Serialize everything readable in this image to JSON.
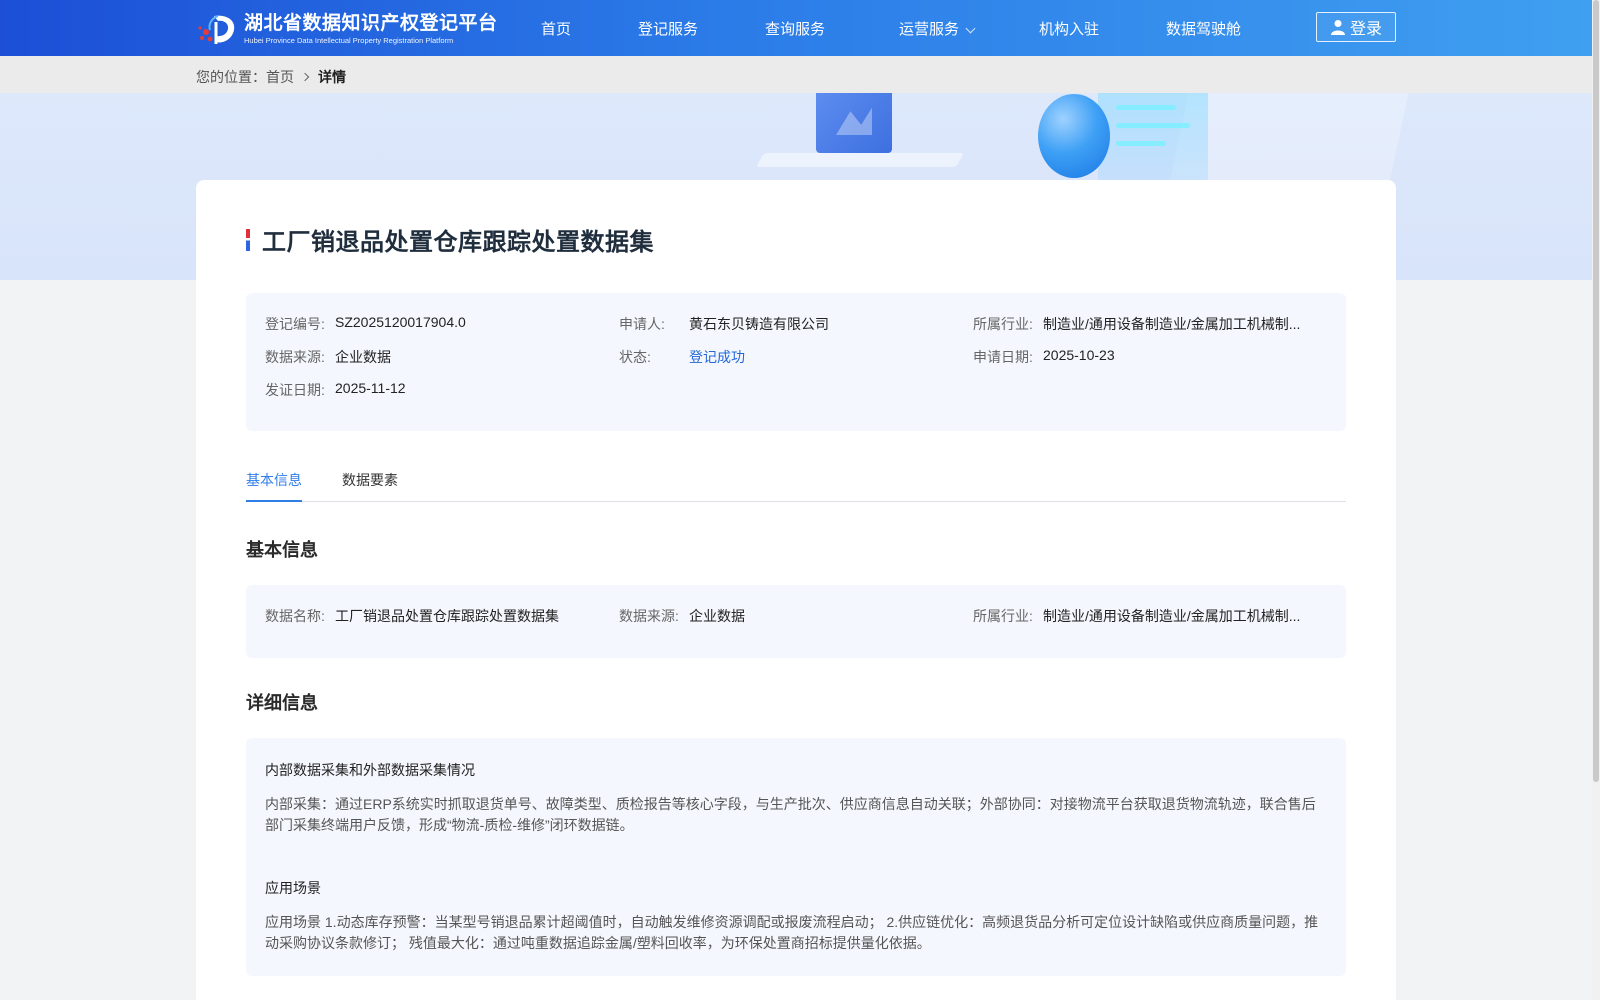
{
  "header": {
    "logo_cn": "湖北省数据知识产权登记平台",
    "logo_en": "Hubei Province Data Intellectual Property Registration Platform",
    "nav": [
      {
        "label": "首页"
      },
      {
        "label": "登记服务"
      },
      {
        "label": "查询服务"
      },
      {
        "label": "运营服务"
      },
      {
        "label": "机构入驻"
      },
      {
        "label": "数据驾驶舱"
      }
    ],
    "login_label": "登录"
  },
  "breadcrumb": {
    "prefix": "您的位置：",
    "home": "首页",
    "current": "详情"
  },
  "record": {
    "title": "工厂销退品处置仓库跟踪处置数据集",
    "fields": {
      "reg_no": {
        "label": "登记编号:",
        "value": "SZ2025120017904.0"
      },
      "applicant": {
        "label": "申请人:",
        "value": "黄石东贝铸造有限公司"
      },
      "industry": {
        "label": "所属行业:",
        "value": "制造业/通用设备制造业/金属加工机械制..."
      },
      "source": {
        "label": "数据来源:",
        "value": "企业数据"
      },
      "status": {
        "label": "状态:",
        "value": "登记成功"
      },
      "apply_date": {
        "label": "申请日期:",
        "value": "2025-10-23"
      },
      "issue_date": {
        "label": "发证日期:",
        "value": "2025-11-12"
      }
    }
  },
  "tabs": [
    {
      "label": "基本信息",
      "active": true
    },
    {
      "label": "数据要素",
      "active": false
    }
  ],
  "basic": {
    "section_title": "基本信息",
    "name": {
      "label": "数据名称:",
      "value": "工厂销退品处置仓库跟踪处置数据集"
    },
    "source": {
      "label": "数据来源:",
      "value": "企业数据"
    },
    "industry": {
      "label": "所属行业:",
      "value": "制造业/通用设备制造业/金属加工机械制..."
    }
  },
  "detail": {
    "section_title": "详细信息",
    "collection_title": "内部数据采集和外部数据采集情况",
    "collection_text": "内部采集：通过ERP系统实时抓取退货单号、故障类型、质检报告等核心字段，与生产批次、供应商信息自动关联；外部协同：对接物流平台获取退货物流轨迹，联合售后部门采集终端用户反馈，形成“物流-质检-维修”闭环数据链。",
    "scenario_title": "应用场景",
    "scenario_text": "应用场景 1.动态库存预警：当某型号销退品累计超阈值时，自动触发维修资源调配或报废流程启动； 2.供应链优化：高频退货品分析可定位设计缺陷或供应商质量问题，推动采购协议条款修订； 残值最大化：通过吨重数据追踪金属/塑料回收率，为环保处置商招标提供量化依据。"
  },
  "colors": {
    "header_start": "#1c4fd6",
    "header_end": "#3f9ff0",
    "accent": "#2f7ee8",
    "success": "#2468d8",
    "panel_bg": "#f4f7fd"
  }
}
